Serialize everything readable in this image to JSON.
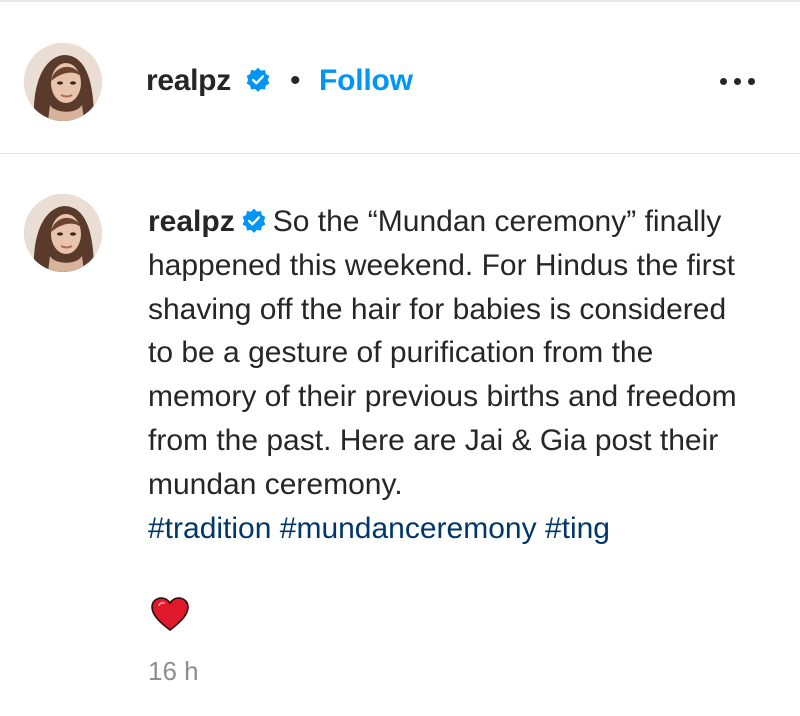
{
  "header": {
    "username": "realpz",
    "separator": "•",
    "follow_label": "Follow",
    "verified_icon": "verified-badge-icon",
    "more_icon": "more-options-icon"
  },
  "caption": {
    "username": "realpz",
    "text": "So the “Mundan ceremony” finally happened this weekend. For Hindus the first shaving off the hair for babies is considered to be a gesture of purification from the memory of their previous births and freedom from the past. Here are Jai & Gia post their mundan ceremony.",
    "hashtags": [
      "#tradition",
      "#mundanceremony",
      "#ting"
    ],
    "emoji_icon": "red-heart-icon",
    "timestamp": "16 h"
  },
  "colors": {
    "follow": "#0095f6",
    "hashtag": "#00376b",
    "verified": "#0095f6",
    "timestamp": "#8e8e8e",
    "heart": "#e0182c"
  }
}
